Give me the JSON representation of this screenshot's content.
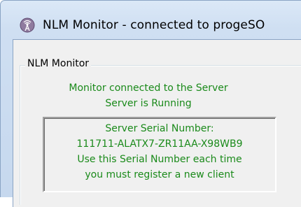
{
  "window": {
    "title": "NLM Monitor - connected to progeSO"
  },
  "group": {
    "legend": "NLM Monitor",
    "status_connected": "Monitor connected to the Server",
    "status_running": "Server is Running"
  },
  "serial_box": {
    "label": "Server Serial Number:",
    "serial": "111711-ALATX7-ZR11AA-X98WB9",
    "note_line1": "Use this Serial Number each time",
    "note_line2": "you must register a new client"
  },
  "colors": {
    "status_text": "#1a8a1a",
    "titlebar": "#cfdff2"
  },
  "icons": {
    "app": "antenna-tower-icon"
  }
}
